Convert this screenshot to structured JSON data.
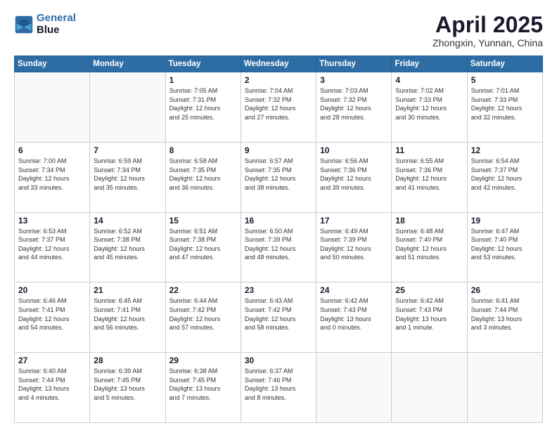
{
  "header": {
    "logo_line1": "General",
    "logo_line2": "Blue",
    "month": "April 2025",
    "location": "Zhongxin, Yunnan, China"
  },
  "weekdays": [
    "Sunday",
    "Monday",
    "Tuesday",
    "Wednesday",
    "Thursday",
    "Friday",
    "Saturday"
  ],
  "weeks": [
    [
      {
        "day": "",
        "info": ""
      },
      {
        "day": "",
        "info": ""
      },
      {
        "day": "1",
        "info": "Sunrise: 7:05 AM\nSunset: 7:31 PM\nDaylight: 12 hours\nand 25 minutes."
      },
      {
        "day": "2",
        "info": "Sunrise: 7:04 AM\nSunset: 7:32 PM\nDaylight: 12 hours\nand 27 minutes."
      },
      {
        "day": "3",
        "info": "Sunrise: 7:03 AM\nSunset: 7:32 PM\nDaylight: 12 hours\nand 28 minutes."
      },
      {
        "day": "4",
        "info": "Sunrise: 7:02 AM\nSunset: 7:33 PM\nDaylight: 12 hours\nand 30 minutes."
      },
      {
        "day": "5",
        "info": "Sunrise: 7:01 AM\nSunset: 7:33 PM\nDaylight: 12 hours\nand 32 minutes."
      }
    ],
    [
      {
        "day": "6",
        "info": "Sunrise: 7:00 AM\nSunset: 7:34 PM\nDaylight: 12 hours\nand 33 minutes."
      },
      {
        "day": "7",
        "info": "Sunrise: 6:59 AM\nSunset: 7:34 PM\nDaylight: 12 hours\nand 35 minutes."
      },
      {
        "day": "8",
        "info": "Sunrise: 6:58 AM\nSunset: 7:35 PM\nDaylight: 12 hours\nand 36 minutes."
      },
      {
        "day": "9",
        "info": "Sunrise: 6:57 AM\nSunset: 7:35 PM\nDaylight: 12 hours\nand 38 minutes."
      },
      {
        "day": "10",
        "info": "Sunrise: 6:56 AM\nSunset: 7:36 PM\nDaylight: 12 hours\nand 39 minutes."
      },
      {
        "day": "11",
        "info": "Sunrise: 6:55 AM\nSunset: 7:36 PM\nDaylight: 12 hours\nand 41 minutes."
      },
      {
        "day": "12",
        "info": "Sunrise: 6:54 AM\nSunset: 7:37 PM\nDaylight: 12 hours\nand 42 minutes."
      }
    ],
    [
      {
        "day": "13",
        "info": "Sunrise: 6:53 AM\nSunset: 7:37 PM\nDaylight: 12 hours\nand 44 minutes."
      },
      {
        "day": "14",
        "info": "Sunrise: 6:52 AM\nSunset: 7:38 PM\nDaylight: 12 hours\nand 45 minutes."
      },
      {
        "day": "15",
        "info": "Sunrise: 6:51 AM\nSunset: 7:38 PM\nDaylight: 12 hours\nand 47 minutes."
      },
      {
        "day": "16",
        "info": "Sunrise: 6:50 AM\nSunset: 7:39 PM\nDaylight: 12 hours\nand 48 minutes."
      },
      {
        "day": "17",
        "info": "Sunrise: 6:49 AM\nSunset: 7:39 PM\nDaylight: 12 hours\nand 50 minutes."
      },
      {
        "day": "18",
        "info": "Sunrise: 6:48 AM\nSunset: 7:40 PM\nDaylight: 12 hours\nand 51 minutes."
      },
      {
        "day": "19",
        "info": "Sunrise: 6:47 AM\nSunset: 7:40 PM\nDaylight: 12 hours\nand 53 minutes."
      }
    ],
    [
      {
        "day": "20",
        "info": "Sunrise: 6:46 AM\nSunset: 7:41 PM\nDaylight: 12 hours\nand 54 minutes."
      },
      {
        "day": "21",
        "info": "Sunrise: 6:45 AM\nSunset: 7:41 PM\nDaylight: 12 hours\nand 56 minutes."
      },
      {
        "day": "22",
        "info": "Sunrise: 6:44 AM\nSunset: 7:42 PM\nDaylight: 12 hours\nand 57 minutes."
      },
      {
        "day": "23",
        "info": "Sunrise: 6:43 AM\nSunset: 7:42 PM\nDaylight: 12 hours\nand 58 minutes."
      },
      {
        "day": "24",
        "info": "Sunrise: 6:42 AM\nSunset: 7:43 PM\nDaylight: 13 hours\nand 0 minutes."
      },
      {
        "day": "25",
        "info": "Sunrise: 6:42 AM\nSunset: 7:43 PM\nDaylight: 13 hours\nand 1 minute."
      },
      {
        "day": "26",
        "info": "Sunrise: 6:41 AM\nSunset: 7:44 PM\nDaylight: 13 hours\nand 3 minutes."
      }
    ],
    [
      {
        "day": "27",
        "info": "Sunrise: 6:40 AM\nSunset: 7:44 PM\nDaylight: 13 hours\nand 4 minutes."
      },
      {
        "day": "28",
        "info": "Sunrise: 6:39 AM\nSunset: 7:45 PM\nDaylight: 13 hours\nand 5 minutes."
      },
      {
        "day": "29",
        "info": "Sunrise: 6:38 AM\nSunset: 7:45 PM\nDaylight: 13 hours\nand 7 minutes."
      },
      {
        "day": "30",
        "info": "Sunrise: 6:37 AM\nSunset: 7:46 PM\nDaylight: 13 hours\nand 8 minutes."
      },
      {
        "day": "",
        "info": ""
      },
      {
        "day": "",
        "info": ""
      },
      {
        "day": "",
        "info": ""
      }
    ]
  ]
}
